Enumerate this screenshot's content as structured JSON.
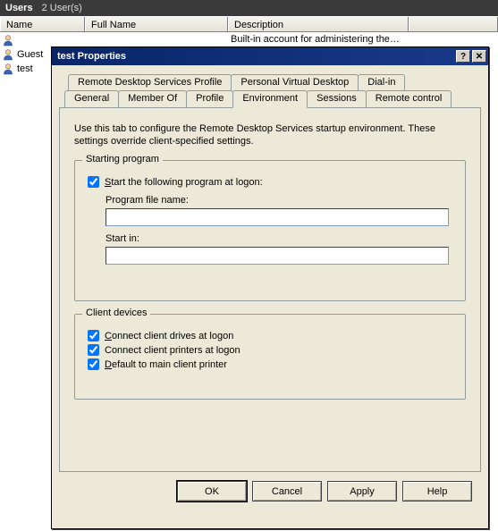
{
  "app": {
    "title": "Users",
    "count_text": "2 User(s)"
  },
  "columns": {
    "name": "Name",
    "full": "Full Name",
    "desc": "Description"
  },
  "rows": {
    "builtin_desc": "Built-in account for administering the…",
    "guest": "Guest",
    "test": "test"
  },
  "dialog": {
    "title": "test Properties",
    "help_glyph": "?",
    "close_glyph": "✕",
    "tabs_top": {
      "rds": "Remote Desktop Services Profile",
      "pvd": "Personal Virtual Desktop",
      "dialin": "Dial-in"
    },
    "tabs_bottom": {
      "general": "General",
      "memberof": "Member Of",
      "profile": "Profile",
      "environment": "Environment",
      "sessions": "Sessions",
      "remote": "Remote control"
    },
    "intro": "Use this tab to configure the Remote Desktop Services startup environment. These settings override client-specified settings.",
    "group_start": {
      "legend": "Starting program",
      "chk_label_pre": "S",
      "chk_label_rest": "tart the following program at logon:",
      "program_label": "Program file name:",
      "program_value": "",
      "startin_label": "Start in:",
      "startin_value": ""
    },
    "group_client": {
      "legend": "Client devices",
      "drives_pre": "C",
      "drives_rest": "onnect client drives at logon",
      "printers_text": "Connect client printers at logon",
      "default_pre": "D",
      "default_rest": "efault to main client printer"
    },
    "buttons": {
      "ok": "OK",
      "cancel": "Cancel",
      "apply": "Apply",
      "help": "Help"
    }
  }
}
